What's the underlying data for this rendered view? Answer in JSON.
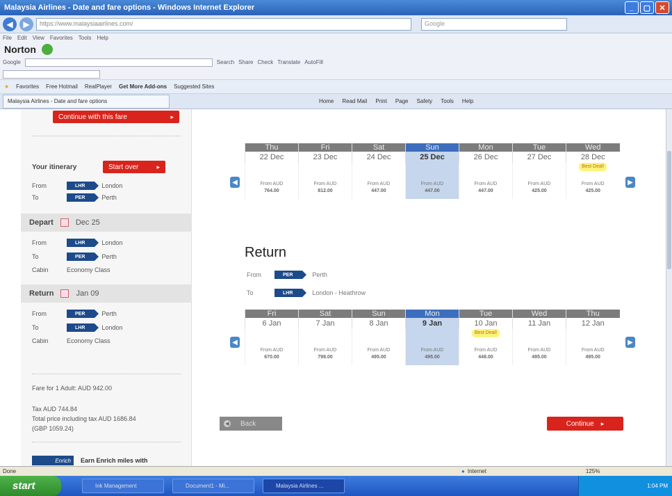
{
  "window": {
    "title": "Malaysia Airlines - Date and fare options - Windows Internet Explorer"
  },
  "browser": {
    "address": "https://www.malaysiaairlines.com/",
    "search_placeholder": "Google",
    "menu": [
      "File",
      "Edit",
      "View",
      "Favorites",
      "Tools",
      "Help"
    ],
    "norton_label": "Norton",
    "google_label": "Google",
    "google_tools": [
      "Search",
      "Share",
      "Check",
      "Translate",
      "AutoFill"
    ],
    "favorites_label": "Favorites",
    "favorites_links": [
      "Free Hotmail",
      "RealPlayer",
      "Get More Add-ons",
      "Suggested Sites"
    ],
    "tab_title": "Malaysia Airlines - Date and fare options",
    "commands": [
      "Home",
      "Read Mail",
      "Print",
      "Page",
      "Safety",
      "Tools",
      "Help"
    ]
  },
  "sidebar": {
    "continue_label": "Continue with this fare",
    "itinerary_label": "Your itinerary",
    "start_over_label": "Start over",
    "from_label": "From",
    "to_label": "To",
    "cabin_label": "Cabin",
    "outbound": {
      "from_code": "LHR",
      "from_city": "London",
      "to_code": "PER",
      "to_city": "Perth"
    },
    "depart": {
      "label": "Depart",
      "date": "Dec 25",
      "from_code": "LHR",
      "from_city": "London",
      "to_code": "PER",
      "to_city": "Perth",
      "cabin": "Economy Class"
    },
    "return": {
      "label": "Return",
      "date": "Jan 09",
      "from_code": "PER",
      "from_city": "Perth",
      "to_code": "LHR",
      "to_city": "London",
      "cabin": "Economy Class"
    },
    "fare_text": "Fare for 1 Adult: AUD 942.00",
    "tax_text": "Tax AUD 744.84",
    "total_text": "Total price including tax AUD 1686.84",
    "gbp_text": "(GBP 1059.24)",
    "enrich_badge": "Enrich",
    "enrich_text": "Earn Enrich miles with"
  },
  "outbound_grid": {
    "days": [
      {
        "dow": "Thu",
        "date": "22 Dec",
        "from": "From AUD",
        "price": "764.00",
        "deal": "",
        "selected": false
      },
      {
        "dow": "Fri",
        "date": "23 Dec",
        "from": "From AUD",
        "price": "812.00",
        "deal": "",
        "selected": false
      },
      {
        "dow": "Sat",
        "date": "24 Dec",
        "from": "From AUD",
        "price": "447.00",
        "deal": "",
        "selected": false
      },
      {
        "dow": "Sun",
        "date": "25 Dec",
        "from": "From AUD",
        "price": "447.00",
        "deal": "",
        "selected": true
      },
      {
        "dow": "Mon",
        "date": "26 Dec",
        "from": "From AUD",
        "price": "447.00",
        "deal": "",
        "selected": false
      },
      {
        "dow": "Tue",
        "date": "27 Dec",
        "from": "From AUD",
        "price": "425.00",
        "deal": "",
        "selected": false
      },
      {
        "dow": "Wed",
        "date": "28 Dec",
        "from": "From AUD",
        "price": "425.00",
        "deal": "Best Deal!",
        "selected": false
      }
    ]
  },
  "return_section": {
    "title": "Return",
    "from_label": "From",
    "to_label": "To",
    "from_code": "PER",
    "from_city": "Perth",
    "to_code": "LHR",
    "to_city": "London - Heathrow"
  },
  "return_grid": {
    "days": [
      {
        "dow": "Fri",
        "date": "6 Jan",
        "from": "From AUD",
        "price": "670.00",
        "deal": "",
        "selected": false
      },
      {
        "dow": "Sat",
        "date": "7 Jan",
        "from": "From AUD",
        "price": "798.00",
        "deal": "",
        "selected": false
      },
      {
        "dow": "Sun",
        "date": "8 Jan",
        "from": "From AUD",
        "price": "495.00",
        "deal": "",
        "selected": false
      },
      {
        "dow": "Mon",
        "date": "9 Jan",
        "from": "From AUD",
        "price": "495.00",
        "deal": "",
        "selected": true
      },
      {
        "dow": "Tue",
        "date": "10 Jan",
        "from": "From AUD",
        "price": "448.00",
        "deal": "Best Deal!",
        "selected": false
      },
      {
        "dow": "Wed",
        "date": "11 Jan",
        "from": "From AUD",
        "price": "495.00",
        "deal": "",
        "selected": false
      },
      {
        "dow": "Thu",
        "date": "12 Jan",
        "from": "From AUD",
        "price": "495.00",
        "deal": "",
        "selected": false
      }
    ]
  },
  "actions": {
    "back_label": "Back",
    "continue_label": "Continue"
  },
  "status": {
    "text": "Done",
    "zone": "Internet",
    "zoom": "125%"
  },
  "taskbar": {
    "start_label": "start",
    "tasks": [
      "Ink Management",
      "Document1 - Mi...",
      "Malaysia Airlines ..."
    ],
    "clock": "1:04 PM"
  },
  "colors": {
    "brand_red": "#d8241c",
    "brand_blue": "#1d4a8a",
    "selected_col": "#c6d6ec",
    "deal_yellow": "#fbf47a"
  }
}
